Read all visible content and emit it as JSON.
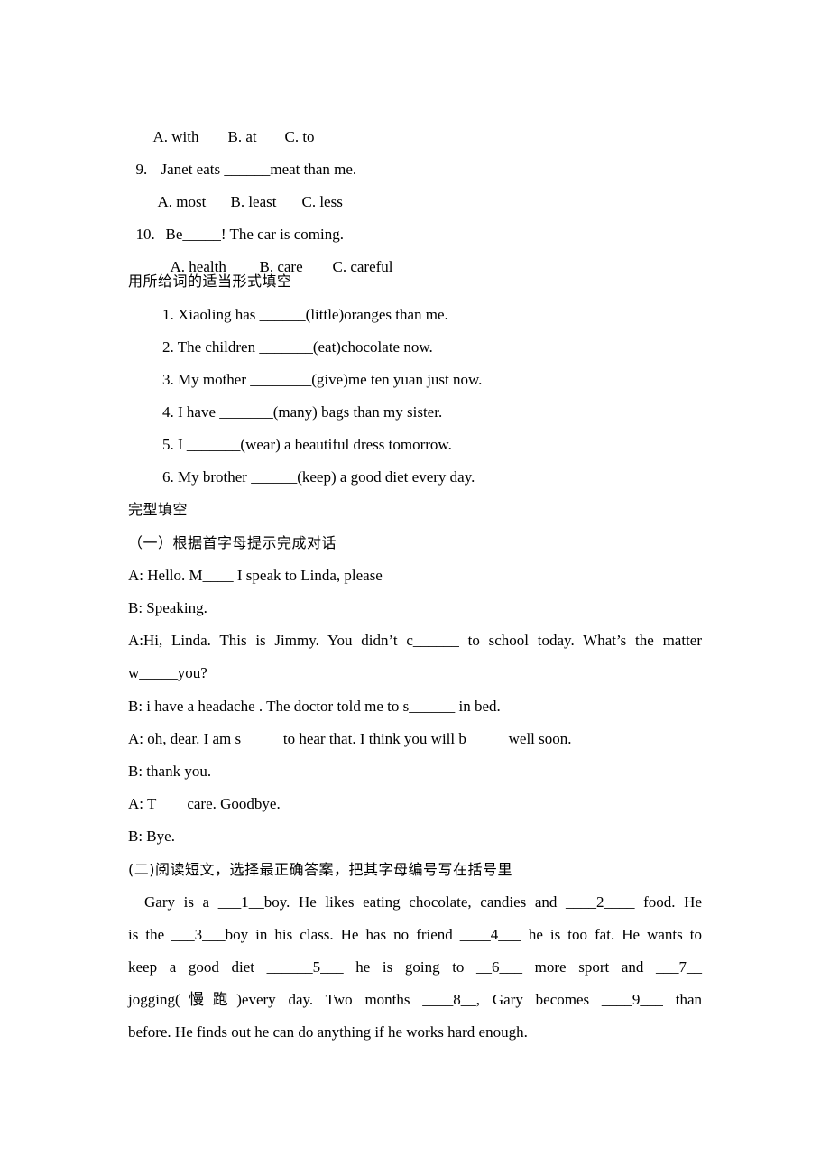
{
  "q8_options": [
    "A. with",
    "B. at",
    "C. to"
  ],
  "q9": {
    "number": "9.",
    "text": "Janet eats ______meat than me.",
    "options": [
      "A. most",
      "B. least",
      "C. less"
    ]
  },
  "q10": {
    "number": "10.",
    "text": "Be_____! The car is coming.",
    "options": [
      "A. health",
      "B. care",
      "C. careful"
    ]
  },
  "section_word_forms": {
    "heading": "用所给词的适当形式填空",
    "items": [
      "1. Xiaoling has ______(little)oranges than me.",
      "2. The children _______(eat)chocolate now.",
      "3. My mother ________(give)me ten yuan just now.",
      "4. I have _______(many) bags than my sister.",
      "5. I _______(wear) a beautiful dress tomorrow.",
      "6. My brother ______(keep) a good diet every day."
    ]
  },
  "section_cloze": {
    "heading": "完型填空",
    "part1": {
      "heading": "（一）根据首字母提示完成对话",
      "dialogue": [
        "A: Hello. M____ I speak to Linda, please",
        "B: Speaking.",
        "A:Hi, Linda. This is Jimmy. You didn’t c______ to school today. What’s the matter",
        "w_____you?",
        "B: i have a headache . The doctor told me to s______ in bed.",
        "A: oh, dear. I am s_____ to hear that. I think you will b_____ well soon.",
        "B: thank you.",
        "A: T____care. Goodbye.",
        "B: Bye."
      ]
    },
    "part2": {
      "heading": "(二)阅读短文，选择最正确答案，把其字母编号写在括号里",
      "passage_lines": [
        "Gary is a ___1__boy. He likes eating chocolate, candies and ____2____ food. He",
        "is the ___3___boy in his class. He has no friend ____4___ he is too fat. He wants to",
        "keep a good diet  ______5___ he is going to __6___ more sport and ___7__",
        "jogging(慢跑)every day. Two months ____8__, Gary becomes ____9___ than",
        "before. He finds out he can do anything if he works hard enough."
      ]
    }
  }
}
